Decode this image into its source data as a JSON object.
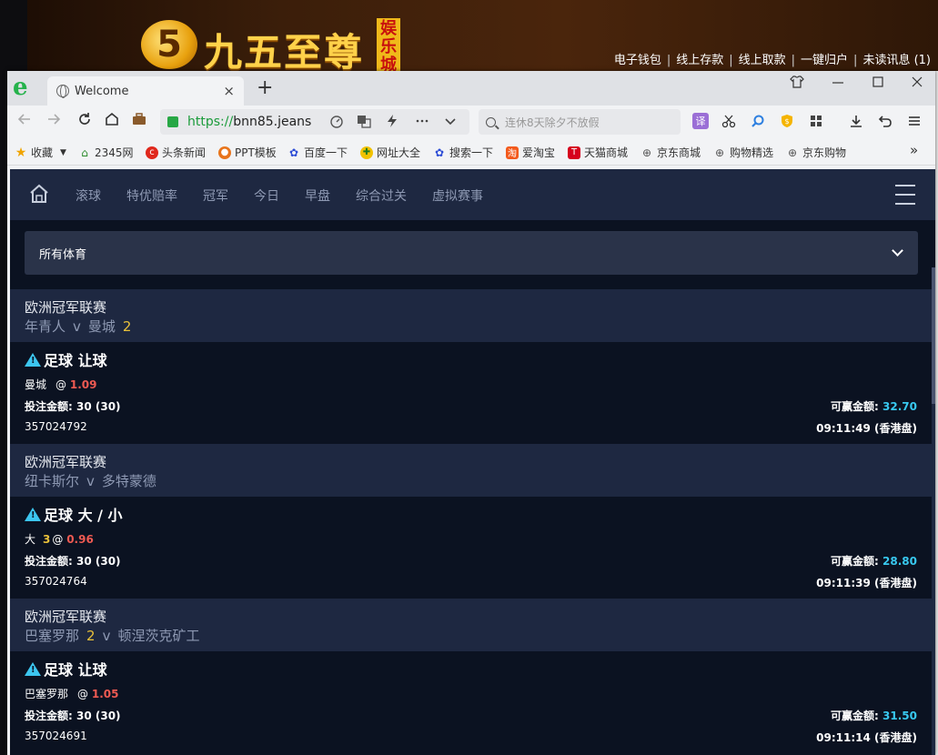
{
  "banner": {
    "logo_char": "5",
    "title": "九五至尊",
    "badge_chars": [
      "娱",
      "乐",
      "城"
    ],
    "links": [
      "电子钱包",
      "线上存款",
      "线上取款",
      "一键归户",
      "未读讯息 (1)"
    ],
    "link_sep": "|"
  },
  "browser": {
    "logo": "e",
    "tab_title": "Welcome",
    "tab_close": "×",
    "new_tab": "+",
    "url_scheme": "https://",
    "url_host": "bnn85.jeans",
    "search_placeholder": "连休8天除夕不放假",
    "translate_label": "译",
    "bookmarks": [
      {
        "label": "收藏",
        "icon": "star-icon"
      },
      {
        "label": "2345网",
        "icon": "2345-icon"
      },
      {
        "label": "头条新闻",
        "icon": "toutiao-icon"
      },
      {
        "label": "PPT模板",
        "icon": "ppt-icon"
      },
      {
        "label": "百度一下",
        "icon": "baidu-icon"
      },
      {
        "label": "网址大全",
        "icon": "wangzhi-icon"
      },
      {
        "label": "搜索一下",
        "icon": "search-paw-icon"
      },
      {
        "label": "爱淘宝",
        "icon": "taobao-icon"
      },
      {
        "label": "天猫商城",
        "icon": "tmall-icon"
      },
      {
        "label": "京东商城",
        "icon": "globe-icon"
      },
      {
        "label": "购物精选",
        "icon": "globe-icon"
      },
      {
        "label": "京东购物",
        "icon": "globe-icon"
      }
    ],
    "more_bookmarks": "»"
  },
  "site": {
    "nav": [
      "滚球",
      "特优赔率",
      "冠军",
      "今日",
      "早盘",
      "综合过关",
      "虚拟赛事"
    ],
    "sport_select": "所有体育",
    "bets": [
      {
        "league": "欧洲冠军联赛",
        "home": "年青人",
        "vs": "v",
        "away": "曼城",
        "score_home": "",
        "score_away": "2",
        "bet_type": "足球 让球",
        "selection": "曼城",
        "handicap": "",
        "at": "@",
        "odds": "1.09",
        "stake_label": "投注金额:",
        "stake": "30 (30)",
        "win_label": "可赢金额:",
        "win": "32.70",
        "ticket_id": "357024792",
        "time": "09:11:49 (香港盘)"
      },
      {
        "league": "欧洲冠军联赛",
        "home": "纽卡斯尔",
        "vs": "v",
        "away": "多特蒙德",
        "score_home": "",
        "score_away": "",
        "bet_type": "足球 大 / 小",
        "selection": "大",
        "handicap": "3",
        "at": "@",
        "odds": "0.96",
        "stake_label": "投注金额:",
        "stake": "30 (30)",
        "win_label": "可赢金额:",
        "win": "28.80",
        "ticket_id": "357024764",
        "time": "09:11:39 (香港盘)"
      },
      {
        "league": "欧洲冠军联赛",
        "home": "巴塞罗那",
        "vs": "v",
        "away": "顿涅茨克矿工",
        "score_home": "2",
        "score_away": "",
        "bet_type": "足球 让球",
        "selection": "巴塞罗那",
        "handicap": "",
        "at": "@",
        "odds": "1.05",
        "stake_label": "投注金额:",
        "stake": "30 (30)",
        "win_label": "可赢金额:",
        "win": "31.50",
        "ticket_id": "357024691",
        "time": "09:11:14 (香港盘)"
      }
    ]
  },
  "colors": {
    "site_bg": "#0b1221",
    "league_bg": "#1e2841",
    "odds": "#ee5a52",
    "win_amount": "#38c8ef",
    "score": "#e9c03a",
    "warning_icon": "#3cc6f0"
  }
}
